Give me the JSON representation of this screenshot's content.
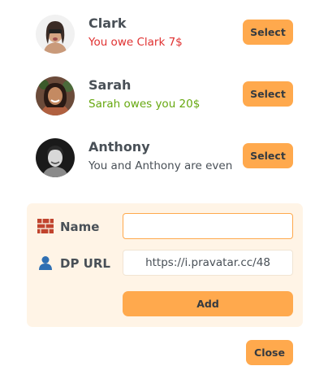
{
  "friends": [
    {
      "name": "Clark",
      "status": "You owe Clark 7$",
      "status_tone": "red",
      "select_label": "Select"
    },
    {
      "name": "Sarah",
      "status": "Sarah owes you 20$",
      "status_tone": "green",
      "select_label": "Select"
    },
    {
      "name": "Anthony",
      "status": "You and Anthony are even",
      "status_tone": "neutral",
      "select_label": "Select"
    }
  ],
  "form": {
    "name_label": "Name",
    "name_icon": "brick-icon",
    "name_value": "",
    "url_label": "DP URL",
    "url_icon": "person-silhouette-icon",
    "url_value": "https://i.pravatar.cc/48",
    "add_label": "Add"
  },
  "close_label": "Close",
  "colors": {
    "accent": "#ffa94d",
    "form_bg": "#fff4e6",
    "red": "#e03131",
    "green": "#66a80f",
    "text": "#495057"
  }
}
